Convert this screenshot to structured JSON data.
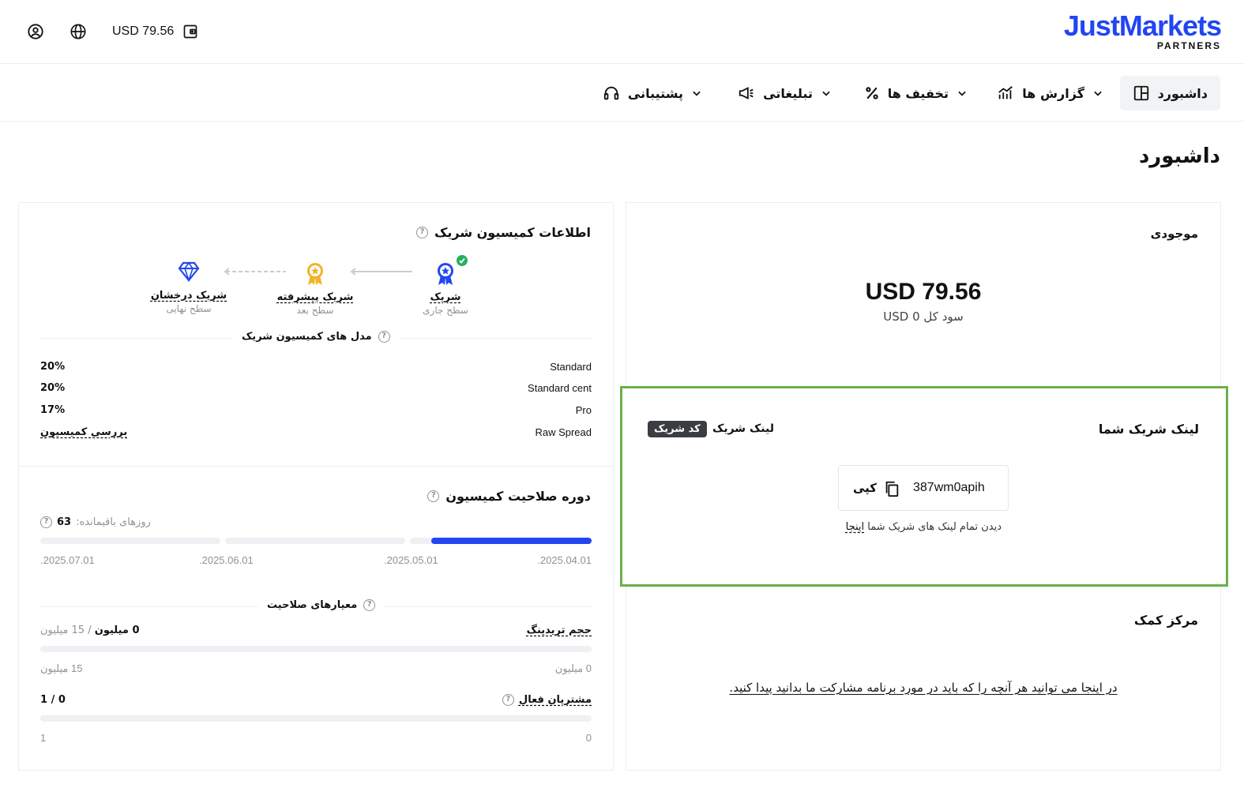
{
  "topbar": {
    "balance": "USD 79.56",
    "logo_main": "JustMarkets",
    "logo_sub": "PARTNERS"
  },
  "nav": {
    "items": [
      {
        "label": "داشبورد",
        "icon": "dashboard-icon",
        "active": true
      },
      {
        "label": "گزارش ها",
        "icon": "chart-icon"
      },
      {
        "label": "تخفیف ها",
        "icon": "percent-icon"
      },
      {
        "label": "تبلیغاتی",
        "icon": "megaphone-icon"
      },
      {
        "label": "پشتیبانی",
        "icon": "headset-icon"
      }
    ]
  },
  "page": {
    "title": "داشبورد"
  },
  "balance_card": {
    "title": "موجودی",
    "amount": "USD 79.56",
    "total_profit": "سود کل USD 0"
  },
  "link_card": {
    "title": "لینک شریک شما",
    "tab_link": "لینک شریک",
    "tab_code": "کد شریک",
    "code": "387wm0apih",
    "copy_label": "کپی",
    "see_all": "دیدن تمام لینک های شریک شما",
    "see_all_link": "اینجا"
  },
  "help_card": {
    "title": "مرکز کمک",
    "text": "در اینجا می توانید هر آنچه را که باید در مورد برنامه مشارکت ما بدانید پیدا کنید."
  },
  "commission_card": {
    "title": "اطلاعات کمیسیون شریک",
    "levels": [
      {
        "name": "شریک",
        "sub": "سطح جاری"
      },
      {
        "name": "شریک پیشرفته",
        "sub": "سطح بعد"
      },
      {
        "name": "شریک درخشان",
        "sub": "سطح نهایی"
      }
    ],
    "models_title": "مدل های کمیسیون شریک",
    "models": [
      {
        "label": "Standard",
        "value": "20%"
      },
      {
        "label": "Standard cent",
        "value": "20%"
      },
      {
        "label": "Pro",
        "value": "17%"
      },
      {
        "label": "Raw Spread",
        "value": "بررسی کمیسیون"
      }
    ]
  },
  "qualification_card": {
    "title": "دوره صلاحیت کمیسیون",
    "days_left_label": "روزهای باقیمانده:",
    "days_left": "63",
    "progress": 0.95,
    "dates": [
      ".2025.04.01",
      ".2025.05.01",
      ".2025.06.01",
      ".2025.07.01"
    ],
    "criteria_title": "معیارهای صلاحیت",
    "volume_label": "حجم تریدینگ",
    "volume_current": "0 میلیون",
    "volume_sep": "/",
    "volume_target": "15 میلیون",
    "volume_progress": 0,
    "volume_min": "0 میلیون",
    "volume_max": "15 میلیون",
    "clients_label": "مشتریان فعال",
    "clients_value": "0 / 1",
    "clients_progress": 0,
    "clients_min": "0",
    "clients_max": "1"
  }
}
